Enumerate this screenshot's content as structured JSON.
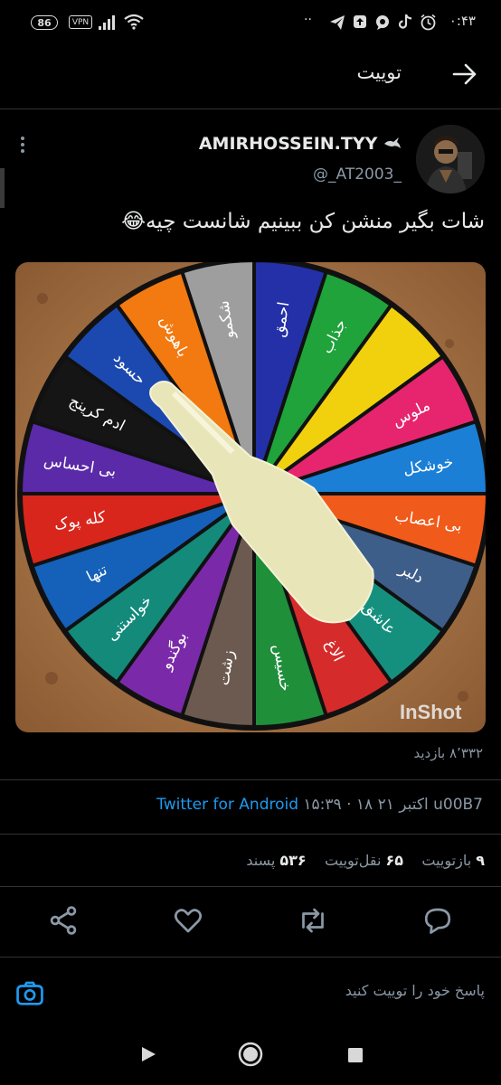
{
  "status_bar": {
    "battery": "86",
    "vpn": "VPN",
    "time": "۰:۴۳"
  },
  "header": {
    "title": "توییت"
  },
  "tweet": {
    "display_name": "AMIRHOSSEIN.TYY",
    "handle": "@_AT2003_",
    "text": "شات بگیر منشن کن ببینیم شانست چیه😂",
    "views": "۸٬۳۳۲ بازدید",
    "timestamp": "۱۵:۳۹ · ۱۸ اکتبر ۲۱ u00B7",
    "source": "Twitter for Android",
    "stats": {
      "retweets_count": "۹",
      "retweets_label": "بازتوییت",
      "quotes_count": "۶۵",
      "quotes_label": "نقل‌توییت",
      "likes_count": "۵۳۶",
      "likes_label": "پسند"
    },
    "media": {
      "watermark": "InShot",
      "wheel_segments": [
        "شکمو",
        "احمق",
        "جذاب",
        "",
        "ملوس",
        "خوشکل",
        "بی اعصاب",
        "دلبر",
        "عاشق",
        "الاغ",
        "خسیس",
        "زشت",
        "بوگندو",
        "خواستنی",
        "تنها",
        "کله پوک",
        "بی احساس",
        "ادم کرینج",
        "حسود",
        "باهوش"
      ],
      "wheel_colors": [
        "#9e9e9e",
        "#2430a8",
        "#1fa33a",
        "#f1d10d",
        "#e7256e",
        "#1b7fd6",
        "#f05a1a",
        "#3e5e8a",
        "#16907e",
        "#d62b2b",
        "#1f8f3a",
        "#6c5a50",
        "#7a2aa8",
        "#138a7a",
        "#1560b8",
        "#d8261c",
        "#5a2aa8",
        "#151515",
        "#1c49b0",
        "#f27a11"
      ]
    }
  },
  "reply": {
    "placeholder": "پاسخ خود را توییت کنید"
  }
}
